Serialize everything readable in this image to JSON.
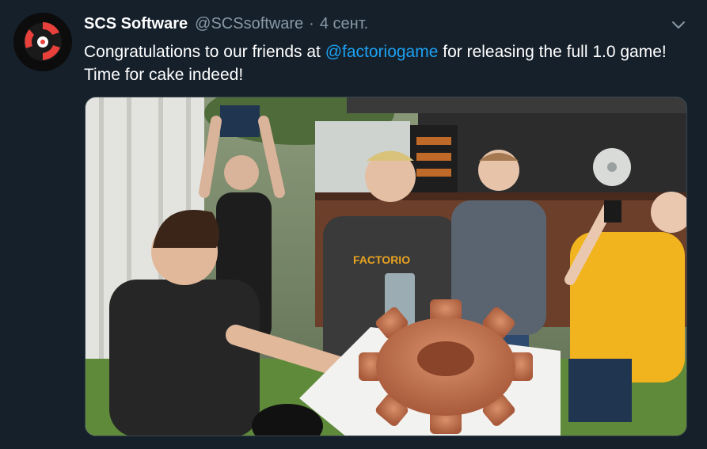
{
  "tweet": {
    "author": {
      "display_name": "SCS Software",
      "handle": "@SCSsoftware",
      "avatar_icon": "scs-logo-icon"
    },
    "separator": "·",
    "timestamp": "4 сент.",
    "text_before": "Congratulations to our friends at ",
    "mention": "@factoriogame",
    "text_after": " for releasing the full 1.0 game! Time for cake indeed!",
    "menu_icon": "chevron-down-icon",
    "media": {
      "description_icon": "photo-image",
      "shirt_text": "FACTORIO"
    }
  },
  "colors": {
    "background": "#15202b",
    "text": "#ffffff",
    "secondary": "#8899a6",
    "link": "#1da1f2",
    "border": "#38444d"
  }
}
